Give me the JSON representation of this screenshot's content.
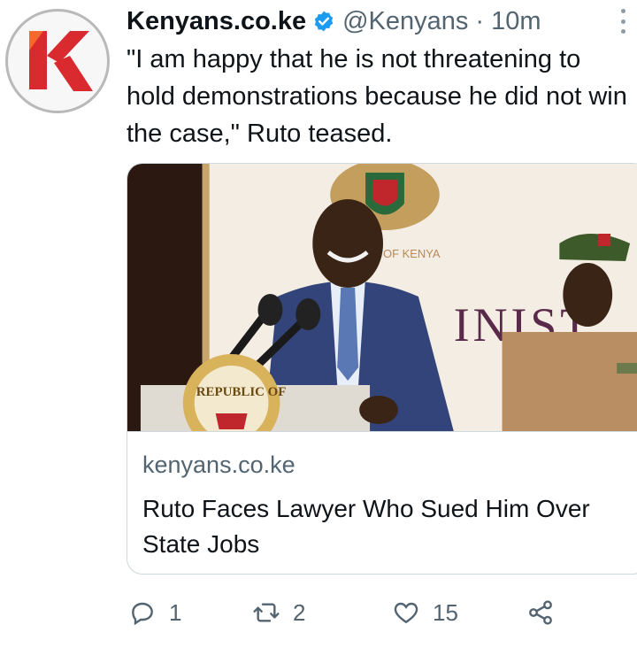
{
  "account": {
    "name": "Kenyans.co.ke",
    "handle": "@Kenyans",
    "separator": "·",
    "time": "10m",
    "avatar_icon": "kenyans-k-logo",
    "verified_icon": "verified-badge-icon"
  },
  "tweet": {
    "text": "\"I am happy that he is not threatening to hold demonstrations because he did not win the case,\" Ruto teased."
  },
  "card": {
    "image_sign_text": "OF KENYA",
    "image_sign_text2": "INIST",
    "podium_seal_text": "REPUBLIC OF",
    "domain": "kenyans.co.ke",
    "title": "Ruto Faces Lawyer Who Sued Him Over State Jobs"
  },
  "actions": {
    "reply_count": "1",
    "retweet_count": "2",
    "like_count": "15"
  },
  "colors": {
    "brand_red": "#d92b2f",
    "verified_blue": "#1d9bf0",
    "muted_text": "#536471",
    "border": "#cfd9de"
  }
}
